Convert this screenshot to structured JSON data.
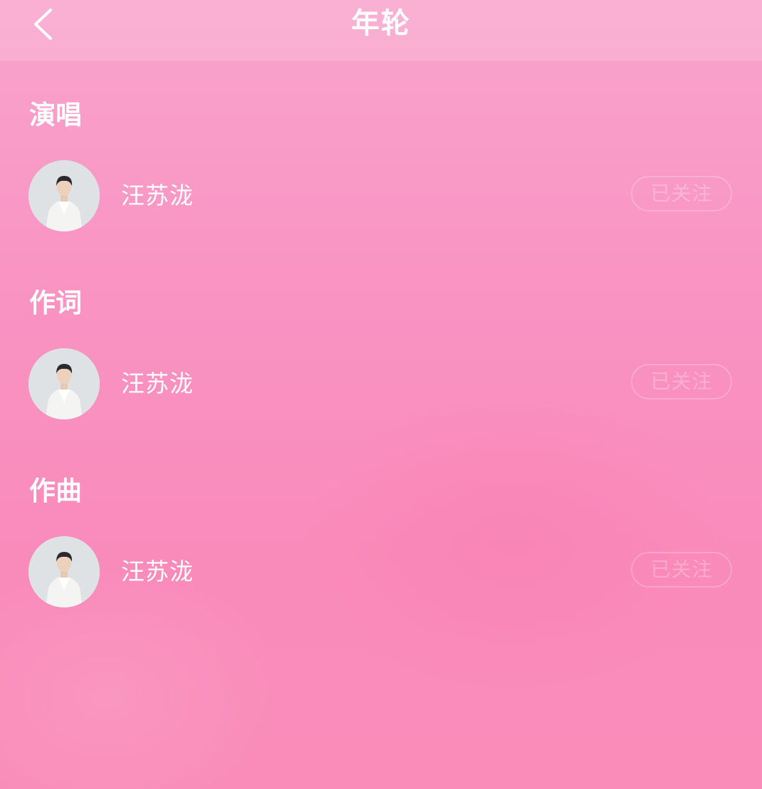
{
  "header": {
    "title": "年轮",
    "back_icon": "chevron-left-icon"
  },
  "sections": [
    {
      "title": "演唱",
      "person": {
        "name": "汪苏泷",
        "follow_label": "已关注"
      }
    },
    {
      "title": "作词",
      "person": {
        "name": "汪苏泷",
        "follow_label": "已关注"
      }
    },
    {
      "title": "作曲",
      "person": {
        "name": "汪苏泷",
        "follow_label": "已关注"
      }
    }
  ],
  "colors": {
    "background_top": "#f9a4cc",
    "background_bottom": "#f98cb9",
    "text": "#ffffff"
  }
}
